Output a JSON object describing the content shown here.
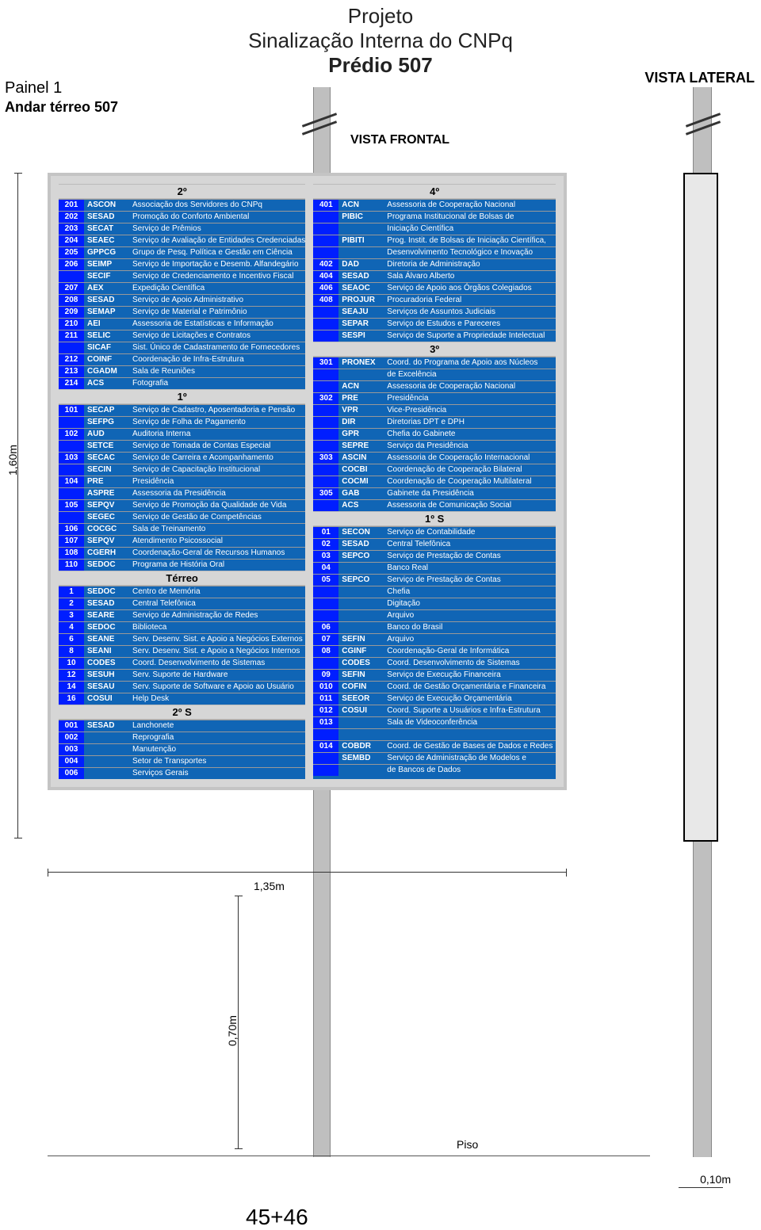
{
  "header": {
    "line1": "Projeto",
    "line2": "Sinalização Interna do CNPq",
    "line3": "Prédio 507"
  },
  "painel": {
    "line1": "Painel  1",
    "line2": "Andar térreo 507"
  },
  "labels": {
    "vista_frontal": "VISTA FRONTAL",
    "vista_lateral": "VISTA LATERAL",
    "piso": "Piso"
  },
  "dims": {
    "board_h": "1,60m",
    "board_w": "1,35m",
    "pole_h": "0,70m",
    "base_w": "0,10m"
  },
  "page_num": "45+46",
  "col_left": [
    {
      "type": "head",
      "label": "2º"
    },
    {
      "room": "201",
      "sigla": "ASCON",
      "desc": "Associação dos Servidores do CNPq"
    },
    {
      "room": "202",
      "sigla": "SESAD",
      "desc": "Promoção do Conforto Ambiental"
    },
    {
      "room": "203",
      "sigla": "SECAT",
      "desc": "Serviço de Prêmios"
    },
    {
      "room": "204",
      "sigla": "SEAEC",
      "desc": "Serviço de Avaliação de Entidades Credenciadas"
    },
    {
      "room": "205",
      "sigla": "GPPCG",
      "desc": "Grupo de  Pesq. Política e Gestão em Ciência"
    },
    {
      "room": "206",
      "sigla": "SEIMP",
      "desc": "Serviço de Importação e Desemb. Alfandegário"
    },
    {
      "room": "",
      "sigla": "SECIF",
      "desc": "Serviço de Credenciamento e Incentivo Fiscal"
    },
    {
      "room": "207",
      "sigla": "AEX",
      "desc": "Expedição Científica"
    },
    {
      "room": "208",
      "sigla": "SESAD",
      "desc": "Serviço de Apoio Administrativo"
    },
    {
      "room": "209",
      "sigla": "SEMAP",
      "desc": "Serviço de Material e Patrimônio"
    },
    {
      "room": "210",
      "sigla": "AEI",
      "desc": "Assessoria de Estatísticas e Informação"
    },
    {
      "room": "211",
      "sigla": "SELIC",
      "desc": "Serviço de Licitações e Contratos"
    },
    {
      "room": "",
      "sigla": "SICAF",
      "desc": "Sist. Único de Cadastramento de Fornecedores"
    },
    {
      "room": "212",
      "sigla": "COINF",
      "desc": "Coordenação de Infra-Estrutura"
    },
    {
      "room": "213",
      "sigla": "CGADM",
      "desc": "Sala de Reuniões"
    },
    {
      "room": "214",
      "sigla": "ACS",
      "desc": "Fotografia"
    },
    {
      "type": "head",
      "label": "1º"
    },
    {
      "room": "101",
      "sigla": "SECAP",
      "desc": "Serviço de Cadastro, Aposentadoria e Pensão"
    },
    {
      "room": "",
      "sigla": "SEFPG",
      "desc": "Serviço de Folha de Pagamento"
    },
    {
      "room": "102",
      "sigla": "AUD",
      "desc": "Auditoria Interna"
    },
    {
      "room": "",
      "sigla": "SETCE",
      "desc": "Serviço de Tomada de Contas Especial"
    },
    {
      "room": "103",
      "sigla": "SECAC",
      "desc": "Serviço de Carreira e Acompanhamento"
    },
    {
      "room": "",
      "sigla": "SECIN",
      "desc": "Serviço de Capacitação Institucional"
    },
    {
      "room": "104",
      "sigla": "PRE",
      "desc": "Presidência"
    },
    {
      "room": "",
      "sigla": "ASPRE",
      "desc": "Assessoria da Presidência"
    },
    {
      "room": "105",
      "sigla": "SEPQV",
      "desc": "Serviço de Promoção da Qualidade de Vida"
    },
    {
      "room": "",
      "sigla": "SEGEC",
      "desc": "Serviço de Gestão de Competências"
    },
    {
      "room": "106",
      "sigla": "COCGC",
      "desc": "Sala de Treinamento"
    },
    {
      "room": "107",
      "sigla": "SEPQV",
      "desc": "Atendimento Psicossocial"
    },
    {
      "room": "108",
      "sigla": "CGERH",
      "desc": "Coordenação-Geral de Recursos Humanos"
    },
    {
      "room": "110",
      "sigla": "SEDOC",
      "desc": "Programa de História Oral"
    },
    {
      "type": "head",
      "label": "Térreo"
    },
    {
      "room": "1",
      "sigla": "SEDOC",
      "desc": "Centro de Memória"
    },
    {
      "room": "2",
      "sigla": "SESAD",
      "desc": "Central Telefônica"
    },
    {
      "room": "3",
      "sigla": "SEARE",
      "desc": "Serviço de Administração de Redes"
    },
    {
      "room": "4",
      "sigla": "SEDOC",
      "desc": "Biblioteca"
    },
    {
      "room": "6",
      "sigla": "SEANE",
      "desc": "Serv. Desenv. Sist. e Apoio a Negócios Externos"
    },
    {
      "room": "8",
      "sigla": "SEANI",
      "desc": "Serv. Desenv. Sist. e Apoio a Negócios Internos"
    },
    {
      "room": "10",
      "sigla": "CODES",
      "desc": "Coord. Desenvolvimento de Sistemas"
    },
    {
      "room": "12",
      "sigla": "SESUH",
      "desc": "Serv. Suporte de Hardware"
    },
    {
      "room": "14",
      "sigla": "SESAU",
      "desc": "Serv. Suporte de Software e Apoio ao Usuário"
    },
    {
      "room": "16",
      "sigla": "COSUI",
      "desc": "Help Desk"
    },
    {
      "type": "head",
      "label": "2º S"
    },
    {
      "room": "001",
      "sigla": "SESAD",
      "desc": "Lanchonete"
    },
    {
      "room": "002",
      "sigla": "",
      "desc": "Reprografia"
    },
    {
      "room": "003",
      "sigla": "",
      "desc": "Manutenção"
    },
    {
      "room": "004",
      "sigla": "",
      "desc": "Setor de Transportes"
    },
    {
      "room": "006",
      "sigla": "",
      "desc": "Serviços Gerais"
    }
  ],
  "col_right": [
    {
      "type": "head",
      "label": "4º"
    },
    {
      "room": "401",
      "sigla": "ACN",
      "desc": "Assessoria de Cooperação Nacional"
    },
    {
      "room": "",
      "sigla": "PIBIC",
      "desc": "Programa Institucional de Bolsas de"
    },
    {
      "room": "",
      "sigla": "",
      "desc": "Iniciação Científica"
    },
    {
      "room": "",
      "sigla": "PIBITI",
      "desc": "Prog. Instit. de Bolsas de Iniciação Científica,"
    },
    {
      "room": "",
      "sigla": "",
      "desc": "Desenvolvimento Tecnológico e Inovação"
    },
    {
      "room": "402",
      "sigla": "DAD",
      "desc": "Diretoria de Administração"
    },
    {
      "room": "404",
      "sigla": "SESAD",
      "desc": "Sala Álvaro Alberto"
    },
    {
      "room": "406",
      "sigla": "SEAOC",
      "desc": "Serviço de Apoio aos Órgãos Colegiados"
    },
    {
      "room": "408",
      "sigla": "PROJUR",
      "desc": "Procuradoria Federal"
    },
    {
      "room": "",
      "sigla": "SEAJU",
      "desc": "Serviços de Assuntos Judiciais"
    },
    {
      "room": "",
      "sigla": "SEPAR",
      "desc": "Serviço de Estudos e Pareceres"
    },
    {
      "room": "",
      "sigla": "SESPI",
      "desc": "Serviço de Suporte a Propriedade Intelectual"
    },
    {
      "type": "head",
      "label": "3º"
    },
    {
      "room": "301",
      "sigla": "PRONEX",
      "desc": "Coord. do Programa de Apoio aos Núcleos"
    },
    {
      "room": "",
      "sigla": "",
      "desc": "de Excelência"
    },
    {
      "room": "",
      "sigla": "ACN",
      "desc": "Assessoria de Cooperação Nacional"
    },
    {
      "room": "302",
      "sigla": "PRE",
      "desc": "Presidência"
    },
    {
      "room": "",
      "sigla": "VPR",
      "desc": "Vice-Presidência"
    },
    {
      "room": "",
      "sigla": "DIR",
      "desc": "Diretorias DPT e DPH"
    },
    {
      "room": "",
      "sigla": "GPR",
      "desc": "Chefia do Gabinete"
    },
    {
      "room": "",
      "sigla": "SEPRE",
      "desc": "Serviço da Presidência"
    },
    {
      "room": "303",
      "sigla": "ASCIN",
      "desc": "Assessoria de Cooperação Internacional"
    },
    {
      "room": "",
      "sigla": "COCBI",
      "desc": "Coordenação de Cooperação Bilateral"
    },
    {
      "room": "",
      "sigla": "COCMI",
      "desc": "Coordenação de Cooperação Multilateral"
    },
    {
      "room": "305",
      "sigla": "GAB",
      "desc": "Gabinete da Presidência"
    },
    {
      "room": "",
      "sigla": "ACS",
      "desc": "Assessoria de Comunicação Social"
    },
    {
      "type": "head",
      "label": "1º S"
    },
    {
      "room": "01",
      "sigla": "SECON",
      "desc": "Serviço de Contabilidade"
    },
    {
      "room": "02",
      "sigla": "SESAD",
      "desc": "Central Telefônica"
    },
    {
      "room": "03",
      "sigla": "SEPCO",
      "desc": "Serviço de Prestação de Contas"
    },
    {
      "room": "04",
      "sigla": "",
      "desc": "Banco Real"
    },
    {
      "room": "05",
      "sigla": "SEPCO",
      "desc": "Serviço de Prestação de Contas"
    },
    {
      "room": "",
      "sigla": "",
      "desc": "Chefia"
    },
    {
      "room": "",
      "sigla": "",
      "desc": "Digitação"
    },
    {
      "room": "",
      "sigla": "",
      "desc": "Arquivo"
    },
    {
      "room": "06",
      "sigla": "",
      "desc": "Banco do Brasil"
    },
    {
      "room": "07",
      "sigla": "SEFIN",
      "desc": "Arquivo"
    },
    {
      "room": "08",
      "sigla": "CGINF",
      "desc": "Coordenação-Geral de Informática"
    },
    {
      "room": "",
      "sigla": "CODES",
      "desc": "Coord. Desenvolvimento de Sistemas"
    },
    {
      "room": "09",
      "sigla": "SEFIN",
      "desc": "Serviço de Execução Financeira"
    },
    {
      "room": "010",
      "sigla": "COFIN",
      "desc": "Coord. de Gestão Orçamentária e Financeira"
    },
    {
      "room": "011",
      "sigla": "SEEOR",
      "desc": "Serviço de Execução Orçamentária"
    },
    {
      "room": "012",
      "sigla": "COSUI",
      "desc": "Coord. Suporte a Usuários e Infra-Estrutura"
    },
    {
      "room": "013",
      "sigla": "",
      "desc": "Sala de Videoconferência"
    },
    {
      "room": "",
      "sigla": "",
      "desc": ""
    },
    {
      "room": "014",
      "sigla": "COBDR",
      "desc": "Coord. de Gestão de Bases de Dados e Redes"
    },
    {
      "room": "",
      "sigla": "SEMBD",
      "desc": "Serviço de Administração de Modelos e"
    },
    {
      "room": "",
      "sigla": "",
      "desc": "de Bancos de Dados"
    }
  ]
}
